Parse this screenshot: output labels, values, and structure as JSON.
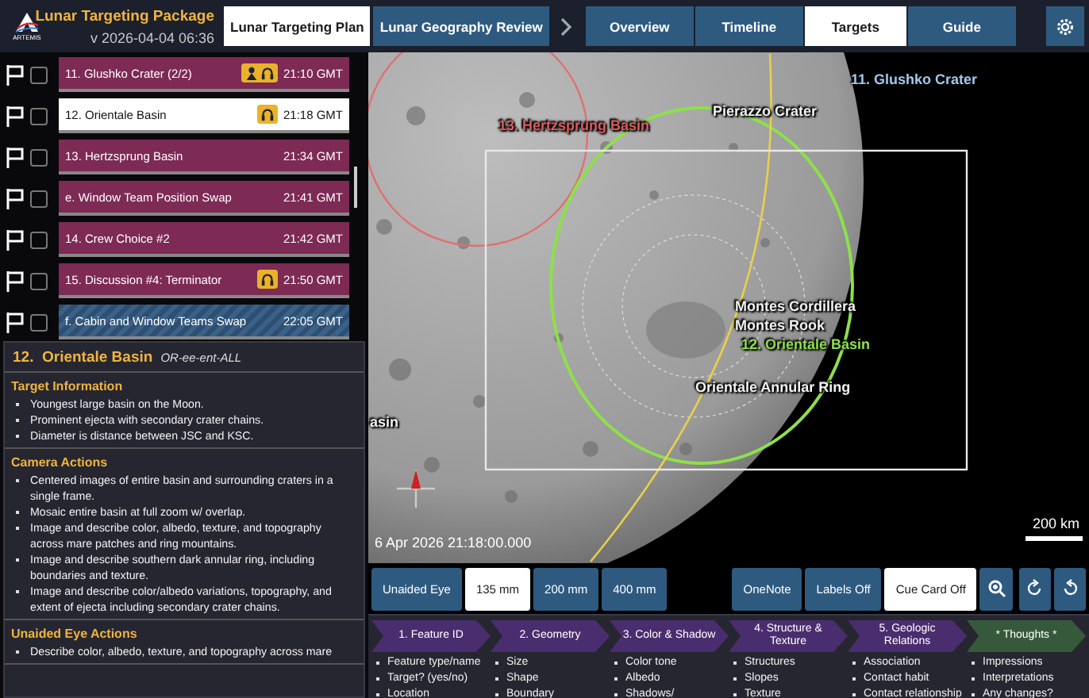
{
  "app": {
    "logo_text": "ARTEMIS",
    "title": "Lunar Targeting Package",
    "version": "v 2026-04-04 06:36"
  },
  "plan_tabs": [
    {
      "label": "Lunar Targeting Plan",
      "selected": true
    },
    {
      "label": "Lunar Geography Review",
      "selected": false
    }
  ],
  "nav_tabs": [
    {
      "label": "Overview",
      "selected": false
    },
    {
      "label": "Timeline",
      "selected": false
    },
    {
      "label": "Targets",
      "selected": true
    },
    {
      "label": "Guide",
      "selected": false
    }
  ],
  "targets": [
    {
      "label": "11. Glushko Crater (2/2)",
      "time": "21:10 GMT",
      "kind": "target",
      "selected": false,
      "flagged": false,
      "checked": false,
      "crew_call": true,
      "audio_call": true
    },
    {
      "label": "12. Orientale Basin",
      "time": "21:18 GMT",
      "kind": "target",
      "selected": true,
      "flagged": false,
      "checked": false,
      "crew_call": false,
      "audio_call": true
    },
    {
      "label": "13. Hertzsprung Basin",
      "time": "21:34 GMT",
      "kind": "target",
      "selected": false,
      "flagged": false,
      "checked": false,
      "crew_call": false,
      "audio_call": false
    },
    {
      "label": "e. Window Team Position Swap",
      "time": "21:41 GMT",
      "kind": "target",
      "selected": false,
      "flagged": false,
      "checked": false,
      "crew_call": false,
      "audio_call": false
    },
    {
      "label": "14. Crew Choice #2",
      "time": "21:42 GMT",
      "kind": "target",
      "selected": false,
      "flagged": false,
      "checked": false,
      "crew_call": false,
      "audio_call": false
    },
    {
      "label": "15. Discussion #4: Terminator",
      "time": "21:50 GMT",
      "kind": "target",
      "selected": false,
      "flagged": false,
      "checked": false,
      "crew_call": false,
      "audio_call": true
    },
    {
      "label": "f. Cabin and Window Teams Swap",
      "time": "22:05 GMT",
      "kind": "break",
      "selected": false,
      "flagged": false,
      "checked": false,
      "crew_call": false,
      "audio_call": false
    }
  ],
  "details": {
    "title": "12.  Orientale Basin",
    "pronunciation": "OR-ee-ent-ALL",
    "sections": [
      {
        "heading": "Target Information",
        "items": [
          "Youngest large basin on the Moon.",
          "Prominent ejecta with secondary crater chains.",
          "Diameter is distance between JSC and KSC."
        ]
      },
      {
        "heading": "Camera Actions",
        "items": [
          "Centered images of entire basin and surrounding craters in a single frame.",
          "Mosaic entire basin at full zoom w/ overlap.",
          "Image and describe color, albedo, texture, and topography across mare patches and ring mountains.",
          "Image and describe southern dark annular ring, including boundaries and texture.",
          "Image and describe color/albedo variations, topography, and extent of ejecta including secondary crater chains."
        ]
      },
      {
        "heading": "Unaided Eye Actions",
        "items": [
          "Describe color, albedo, texture, and topography across mare"
        ]
      }
    ]
  },
  "map": {
    "labels": [
      {
        "text": "11. Glushko Crater",
        "color": "#9fc8ec"
      },
      {
        "text": "13. Hertzsprung Basin",
        "color": "#e05a5a"
      },
      {
        "text": "Pierazzo Crater"
      },
      {
        "text": "Montes Cordillera"
      },
      {
        "text": "Montes Rook"
      },
      {
        "text": "12. Orientale Basin",
        "color": "#8ee04a"
      },
      {
        "text": "Orientale Annular Ring"
      },
      {
        "text": "asin"
      }
    ],
    "timestamp": "6 Apr 2026 21:18:00.000",
    "scale": "200 km"
  },
  "lens_buttons": [
    {
      "label": "Unaided Eye",
      "selected": false
    },
    {
      "label": "135 mm",
      "selected": true
    },
    {
      "label": "200 mm",
      "selected": false
    },
    {
      "label": "400 mm",
      "selected": false
    }
  ],
  "tool_buttons": [
    {
      "label": "OneNote",
      "selected": false
    },
    {
      "label": "Labels Off",
      "selected": false
    },
    {
      "label": "Cue Card Off",
      "selected": true
    }
  ],
  "steps": [
    {
      "title": "1. Feature ID",
      "kind": "step",
      "items": [
        "Feature type/name",
        "Target? (yes/no)",
        "Location"
      ]
    },
    {
      "title": "2. Geometry",
      "kind": "step",
      "items": [
        "Size",
        "Shape",
        "Boundary"
      ]
    },
    {
      "title": "3. Color & Shadow",
      "kind": "step",
      "items": [
        "Color tone",
        "Albedo",
        "Shadows/"
      ]
    },
    {
      "title": "4. Structure & Texture",
      "kind": "step",
      "items": [
        "Structures",
        "Slopes",
        "Texture"
      ]
    },
    {
      "title": "5. Geologic Relations",
      "kind": "step",
      "items": [
        "Association",
        "Contact habit",
        "Contact relationship"
      ]
    },
    {
      "title": "* Thoughts *",
      "kind": "thoughts",
      "items": [
        "Impressions",
        "Interpretations",
        "Any changes?"
      ]
    }
  ]
}
